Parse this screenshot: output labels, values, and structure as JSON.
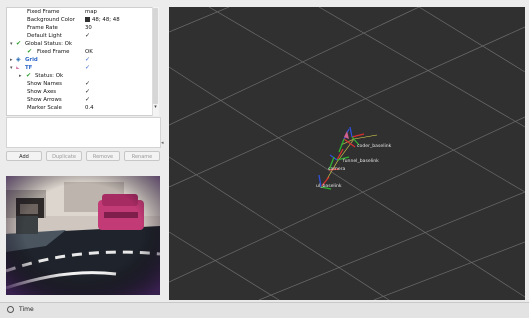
{
  "displays_tree": {
    "rows": [
      {
        "name": "Fixed Frame",
        "value": "map"
      },
      {
        "name": "Background Color",
        "value": "48; 48; 48",
        "swatch": "#303030"
      },
      {
        "name": "Frame Rate",
        "value": "30"
      },
      {
        "name": "Default Light",
        "value": "✓"
      },
      {
        "name": "Global Status: Ok",
        "value": ""
      },
      {
        "name": "Fixed Frame",
        "value": "OK"
      },
      {
        "name": "Grid",
        "value": "✓"
      },
      {
        "name": "TF",
        "value": "✓"
      },
      {
        "name": "Status: Ok",
        "value": ""
      },
      {
        "name": "Show Names",
        "value": "✓"
      },
      {
        "name": "Show Axes",
        "value": "✓"
      },
      {
        "name": "Show Arrows",
        "value": "✓"
      },
      {
        "name": "Marker Scale",
        "value": "0.4"
      }
    ]
  },
  "buttons": {
    "add": "Add",
    "duplicate": "Duplicate",
    "remove": "Remove",
    "rename": "Rename"
  },
  "viewport": {
    "background": "#303030",
    "frames": {
      "coder_baselink": "coder_baselink",
      "funnel_baselink": "funnel_baselink",
      "camera": "camera",
      "ul_baselink": "ul_baselink"
    }
  },
  "status_bar": {
    "time_label": "Time"
  }
}
